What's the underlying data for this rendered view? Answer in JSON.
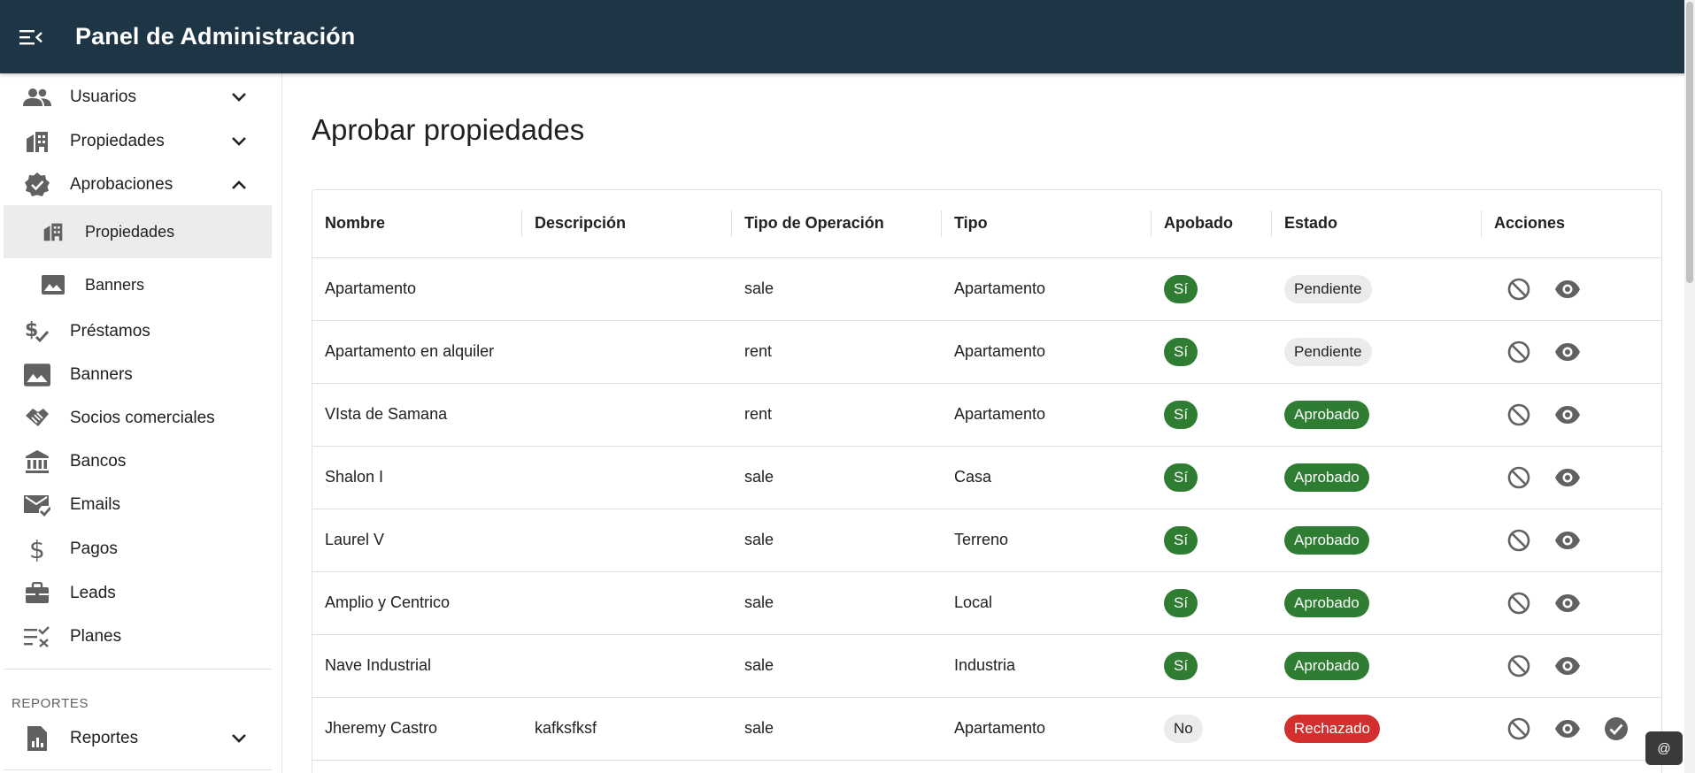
{
  "header": {
    "title": "Panel de Administración",
    "menu_icon": "menu-open-icon"
  },
  "sidebar": {
    "items": [
      {
        "label": "Usuarios",
        "icon": "people-icon",
        "expandable": true,
        "expanded": false
      },
      {
        "label": "Propiedades",
        "icon": "buildings-icon",
        "expandable": true,
        "expanded": false
      },
      {
        "label": "Aprobaciones",
        "icon": "verified-badge-icon",
        "expandable": true,
        "expanded": true
      },
      {
        "label": "Propiedades",
        "icon": "buildings-icon",
        "sub": true,
        "active": true
      },
      {
        "label": "Banners",
        "icon": "image-icon",
        "sub": true
      },
      {
        "label": "Préstamos",
        "icon": "money-check-icon"
      },
      {
        "label": "Banners",
        "icon": "image-icon"
      },
      {
        "label": "Socios comerciales",
        "icon": "handshake-icon"
      },
      {
        "label": "Bancos",
        "icon": "bank-icon"
      },
      {
        "label": "Emails",
        "icon": "mark-email-read-icon"
      },
      {
        "label": "Pagos",
        "icon": "dollar-icon"
      },
      {
        "label": "Leads",
        "icon": "briefcase-icon"
      },
      {
        "label": "Planes",
        "icon": "checklist-icon"
      }
    ],
    "section_label": "REPORTES",
    "report_item": {
      "label": "Reportes",
      "icon": "report-icon",
      "expandable": true
    }
  },
  "main": {
    "title": "Aprobar propiedades",
    "columns": [
      "Nombre",
      "Descripción",
      "Tipo de Operación",
      "Tipo",
      "Apobado",
      "Estado",
      "Acciones"
    ],
    "rows": [
      {
        "nombre": "Apartamento",
        "descripcion": "",
        "operacion": "sale",
        "tipo": "Apartamento",
        "aprobado": "Sí",
        "estado": "Pendiente"
      },
      {
        "nombre": "Apartamento en alquiler",
        "descripcion": "",
        "operacion": "rent",
        "tipo": "Apartamento",
        "aprobado": "Sí",
        "estado": "Pendiente"
      },
      {
        "nombre": "VIsta de Samana",
        "descripcion": "",
        "operacion": "rent",
        "tipo": "Apartamento",
        "aprobado": "Sí",
        "estado": "Aprobado"
      },
      {
        "nombre": "Shalon I",
        "descripcion": "",
        "operacion": "sale",
        "tipo": "Casa",
        "aprobado": "Sí",
        "estado": "Aprobado"
      },
      {
        "nombre": "Laurel V",
        "descripcion": "",
        "operacion": "sale",
        "tipo": "Terreno",
        "aprobado": "Sí",
        "estado": "Aprobado"
      },
      {
        "nombre": "Amplio y Centrico",
        "descripcion": "",
        "operacion": "sale",
        "tipo": "Local",
        "aprobado": "Sí",
        "estado": "Aprobado"
      },
      {
        "nombre": "Nave Industrial",
        "descripcion": "",
        "operacion": "sale",
        "tipo": "Industria",
        "aprobado": "Sí",
        "estado": "Aprobado"
      },
      {
        "nombre": "Jheremy Castro",
        "descripcion": "kafksfksf",
        "operacion": "sale",
        "tipo": "Apartamento",
        "aprobado": "No",
        "estado": "Rechazado",
        "approve_action": true
      }
    ]
  },
  "floating_button": {
    "label": "@"
  },
  "colors": {
    "appbar": "#1e3546",
    "chip_green": "#2e7d32",
    "chip_red": "#d32f2f",
    "chip_grey": "#ebebeb",
    "icon": "#616161"
  }
}
